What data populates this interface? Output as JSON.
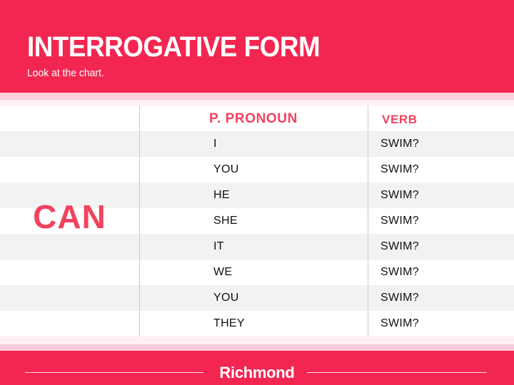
{
  "slide": {
    "title": "INTERROGATIVE FORM",
    "subtitle": "Look at the chart.",
    "accent_color": "#f22651",
    "accent_text_color": "#f2425f",
    "stripe_color": "#f2f2f2",
    "band_pink": "#fbd0dd",
    "band_pale_pink": "#fdf2f6"
  },
  "chart_data": {
    "type": "table",
    "title": "INTERROGATIVE FORM",
    "modal": "CAN",
    "columns": [
      "",
      "P. PRONOUN",
      "VERB"
    ],
    "rows": [
      {
        "pronoun": "I",
        "verb": "SWIM?"
      },
      {
        "pronoun": "YOU",
        "verb": "SWIM?"
      },
      {
        "pronoun": "HE",
        "verb": "SWIM?"
      },
      {
        "pronoun": "SHE",
        "verb": "SWIM?"
      },
      {
        "pronoun": "IT",
        "verb": "SWIM?"
      },
      {
        "pronoun": "WE",
        "verb": "SWIM?"
      },
      {
        "pronoun": "YOU",
        "verb": "SWIM?"
      },
      {
        "pronoun": "THEY",
        "verb": "SWIM?"
      }
    ]
  },
  "footer": {
    "logo": "Richmond"
  }
}
